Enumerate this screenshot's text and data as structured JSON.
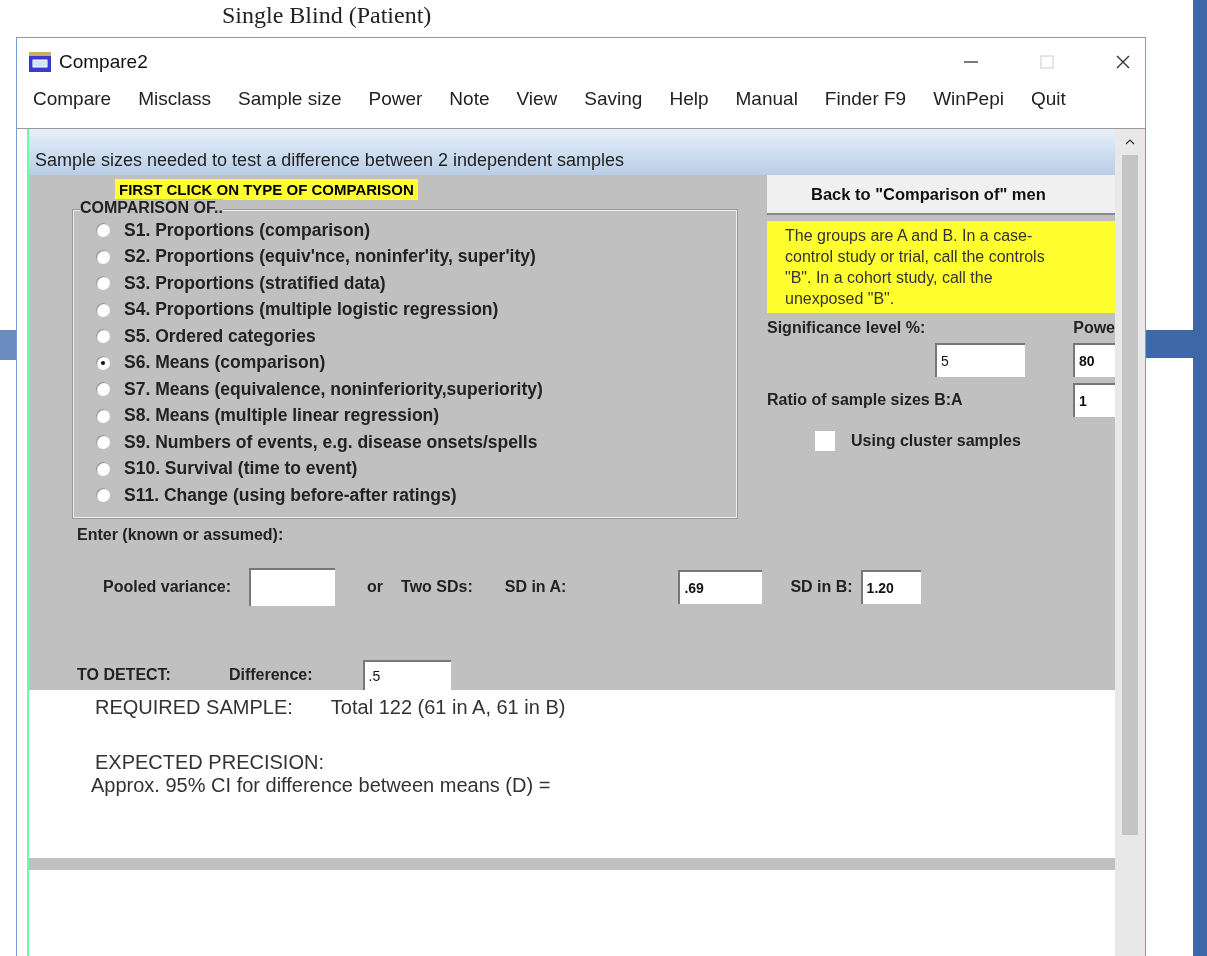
{
  "background_document": {
    "heading": "Single Blind (Patient)"
  },
  "window": {
    "title": "Compare2"
  },
  "menu": [
    {
      "label": "Compare"
    },
    {
      "label": "Misclass"
    },
    {
      "label": "Sample size"
    },
    {
      "label": "Power"
    },
    {
      "label": "Note"
    },
    {
      "label": "View"
    },
    {
      "label": "Saving"
    },
    {
      "label": "Help"
    },
    {
      "label": "Manual"
    },
    {
      "label": "Finder F9"
    },
    {
      "label": "WinPepi"
    },
    {
      "label": "Quit"
    }
  ],
  "header": "Sample sizes needed to test a difference between 2 independent samples",
  "instruction": "FIRST CLICK ON TYPE OF COMPARISON",
  "comparison_group": {
    "title": "COMPARISON OF..",
    "options": [
      {
        "label": "S1. Proportions (comparison)",
        "selected": false
      },
      {
        "label": "S2. Proportions (equiv'nce, noninfer'ity, super'ity)",
        "selected": false
      },
      {
        "label": "S3. Proportions (stratified data)",
        "selected": false
      },
      {
        "label": "S4. Proportions (multiple logistic regression)",
        "selected": false
      },
      {
        "label": "S5. Ordered categories",
        "selected": false
      },
      {
        "label": "S6. Means (comparison)",
        "selected": true
      },
      {
        "label": "S7. Means (equivalence, noninferiority,superiority)",
        "selected": false
      },
      {
        "label": "S8. Means (multiple linear regression)",
        "selected": false
      },
      {
        "label": "S9. Numbers of events, e.g. disease onsets/spells",
        "selected": false
      },
      {
        "label": "S10. Survival (time to event)",
        "selected": false
      },
      {
        "label": "S11. Change (using before-after ratings)",
        "selected": false
      }
    ]
  },
  "back_button": "Back to \"Comparison of\" men",
  "note": "The groups are A and B.  In a case-control study or trial, call the controls \"B\".  In a cohort study, call the unexposed \"B\".",
  "significance": {
    "label": "Significance level %:",
    "value": "5"
  },
  "power": {
    "label": "Powe",
    "value": "80"
  },
  "ratio": {
    "label": "Ratio of sample sizes B:A",
    "value": "1"
  },
  "cluster": {
    "label": "Using cluster samples",
    "checked": false
  },
  "enter_label": "Enter (known or assumed):",
  "pooled": {
    "label": "Pooled variance:"
  },
  "or_label": "or",
  "two_sds_label": "Two SDs:",
  "sd_a": {
    "label": "SD in A:",
    "value": ".69"
  },
  "sd_b": {
    "label": "SD in B:",
    "value": "1.20"
  },
  "detect": {
    "label": "TO  DETECT:",
    "diff_label": "Difference:",
    "value": ".5"
  },
  "result": {
    "required_label": "REQUIRED SAMPLE:",
    "required_value": "Total 122  (61 in A, 61 in B)",
    "precision_label": "EXPECTED PRECISION:",
    "precision_text": "Approx. 95% CI for difference between means (D) ="
  }
}
